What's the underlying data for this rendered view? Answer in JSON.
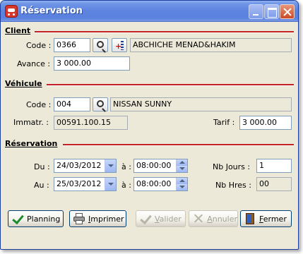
{
  "window": {
    "title": "Réservation"
  },
  "client": {
    "section_title": "Client",
    "code_label": "Code :",
    "code_value": "0366",
    "name_value": "ABCHICHE MENAD&HAKIM",
    "avance_label": "Avance :",
    "avance_value": "3 000.00"
  },
  "vehicule": {
    "section_title": "Véhicule",
    "code_label": "Code :",
    "code_value": "004",
    "name_value": "NISSAN SUNNY",
    "immatr_label": "Immatr. :",
    "immatr_value": "00591.100.15",
    "tarif_label": "Tarif :",
    "tarif_value": "3 000.00"
  },
  "reservation": {
    "section_title": "Réservation",
    "du_label": "Du :",
    "du_date": "24/03/2012",
    "a1_label": "à :",
    "du_time": "08:00:00",
    "au_label": "Au :",
    "au_date": "25/03/2012",
    "a2_label": "à :",
    "au_time": "08:00:00",
    "nb_jours_label": "Nb Jours :",
    "nb_jours_value": "1",
    "nb_hres_label": "Nb Hres :",
    "nb_hres_value": "00"
  },
  "buttons": {
    "planning": "Planning",
    "imprimer_u": "I",
    "imprimer_rest": "mprimer",
    "valider_u": "V",
    "valider_rest": "alider",
    "annuler_u": "A",
    "annuler_rest": "nnuler",
    "fermer_u": "F",
    "fermer_rest": "ermer"
  },
  "colors": {
    "title_bar": "#5a82de",
    "section_rule": "#c42126",
    "dialog_bg": "#ece9d8",
    "field_border": "#7f9db9"
  },
  "icons": {
    "app": "car-icon",
    "client_search": "magnifier-icon",
    "client_add": "add-to-list-icon",
    "vehicle_search": "magnifier-icon",
    "planning": "check-icon",
    "imprimer": "printer-icon",
    "valider": "check-icon",
    "annuler": "cross-icon",
    "fermer": "door-exit-icon"
  }
}
